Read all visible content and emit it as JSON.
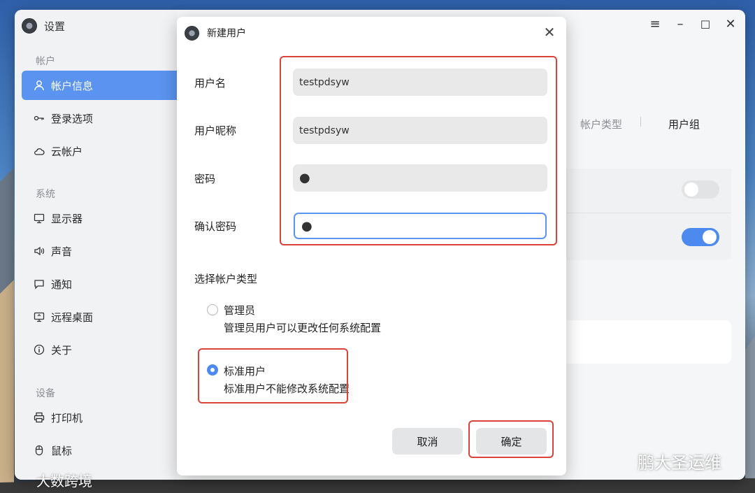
{
  "app": {
    "title": "设置",
    "sidebar": {
      "groups": [
        {
          "title": "帐户",
          "items": [
            {
              "label": "帐户信息",
              "icon": "user-icon",
              "active": true
            },
            {
              "label": "登录选项",
              "icon": "key-icon"
            },
            {
              "label": "云帐户",
              "icon": "cloud-icon"
            }
          ]
        },
        {
          "title": "系统",
          "items": [
            {
              "label": "显示器",
              "icon": "monitor-icon"
            },
            {
              "label": "声音",
              "icon": "speaker-icon"
            },
            {
              "label": "通知",
              "icon": "chat-bubble-icon"
            },
            {
              "label": "远程桌面",
              "icon": "remote-desktop-icon"
            },
            {
              "label": "关于",
              "icon": "info-icon"
            }
          ]
        },
        {
          "title": "设备",
          "items": [
            {
              "label": "打印机",
              "icon": "printer-icon"
            },
            {
              "label": "鼠标",
              "icon": "mouse-icon"
            }
          ]
        }
      ]
    },
    "main": {
      "tabs": [
        "帐户类型",
        "用户组"
      ],
      "toggles": [
        {
          "state": "off"
        },
        {
          "state": "on"
        }
      ]
    },
    "colors": {
      "accent": "#5b93f0",
      "highlight_box": "#d9433a"
    }
  },
  "dialog": {
    "title": "新建用户",
    "fields": {
      "username": {
        "label": "用户名",
        "value": "testpdsyw"
      },
      "nickname": {
        "label": "用户昵称",
        "value": "testpdsyw"
      },
      "password": {
        "label": "密码",
        "value": "●"
      },
      "confirm": {
        "label": "确认密码",
        "value": "●"
      }
    },
    "account_type": {
      "label": "选择帐户类型",
      "options": [
        {
          "title": "管理员",
          "desc": "管理员用户可以更改任何系统配置",
          "checked": false
        },
        {
          "title": "标准用户",
          "desc": "标准用户不能修改系统配置",
          "checked": true
        }
      ]
    },
    "buttons": {
      "cancel": "取消",
      "confirm": "确定"
    }
  },
  "watermarks": {
    "left": "大数跨境",
    "right": "鹏大圣运维"
  }
}
